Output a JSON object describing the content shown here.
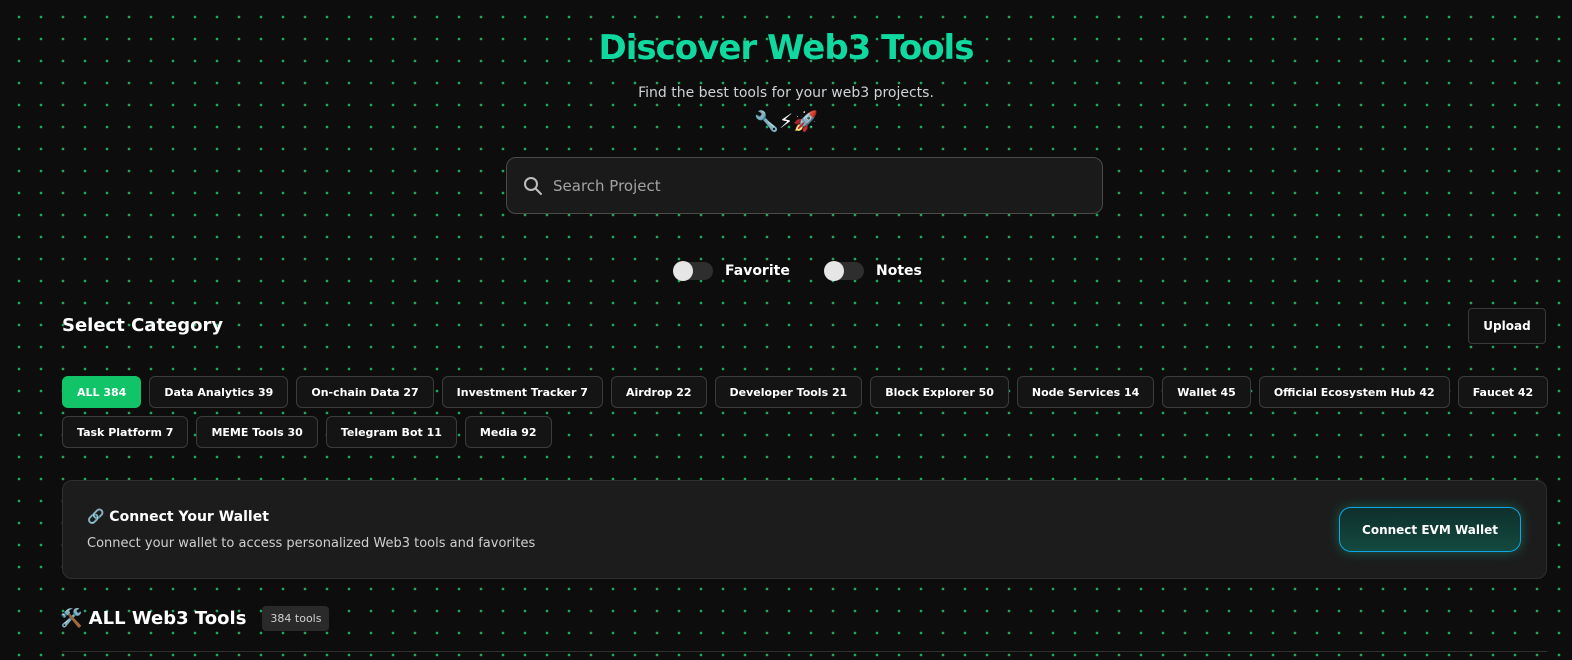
{
  "hero": {
    "title": "Discover Web3 Tools",
    "subtitle": "Find the best tools for your web3 projects.",
    "emojis": "🔧⚡🚀"
  },
  "search": {
    "placeholder": "Search Project",
    "value": "",
    "icon": "search-icon"
  },
  "toggles": [
    {
      "label": "Favorite",
      "on": false
    },
    {
      "label": "Notes",
      "on": false
    }
  ],
  "category": {
    "title": "Select Category",
    "upload_label": "Upload",
    "chips_row1": [
      {
        "label": "ALL 384",
        "active": true
      },
      {
        "label": "Data Analytics 39",
        "active": false
      },
      {
        "label": "On-chain Data 27",
        "active": false
      },
      {
        "label": "Investment Tracker 7",
        "active": false
      },
      {
        "label": "Airdrop 22",
        "active": false
      },
      {
        "label": "Developer Tools 21",
        "active": false
      },
      {
        "label": "Block Explorer 50",
        "active": false
      },
      {
        "label": "Node Services 14",
        "active": false
      },
      {
        "label": "Wallet 45",
        "active": false
      },
      {
        "label": "Official Ecosystem Hub 42",
        "active": false
      },
      {
        "label": "Faucet 42",
        "active": false
      }
    ],
    "chips_row2": [
      {
        "label": "Task Platform 7",
        "active": false
      },
      {
        "label": "MEME Tools 30",
        "active": false
      },
      {
        "label": "Telegram Bot 11",
        "active": false
      },
      {
        "label": "Media 92",
        "active": false
      }
    ]
  },
  "wallet": {
    "title": "🔗 Connect Your Wallet",
    "description": "Connect your wallet to access personalized Web3 tools and favorites",
    "button_label": "Connect EVM Wallet"
  },
  "tools": {
    "title": "🛠️ ALL Web3 Tools",
    "count": "384 tools"
  },
  "colors": {
    "accent": "#10d9a0",
    "active_chip": "#10c467",
    "background": "#0d0d0d",
    "dot": "#1fa85e",
    "wallet_button_border": "#0ea5e9"
  }
}
